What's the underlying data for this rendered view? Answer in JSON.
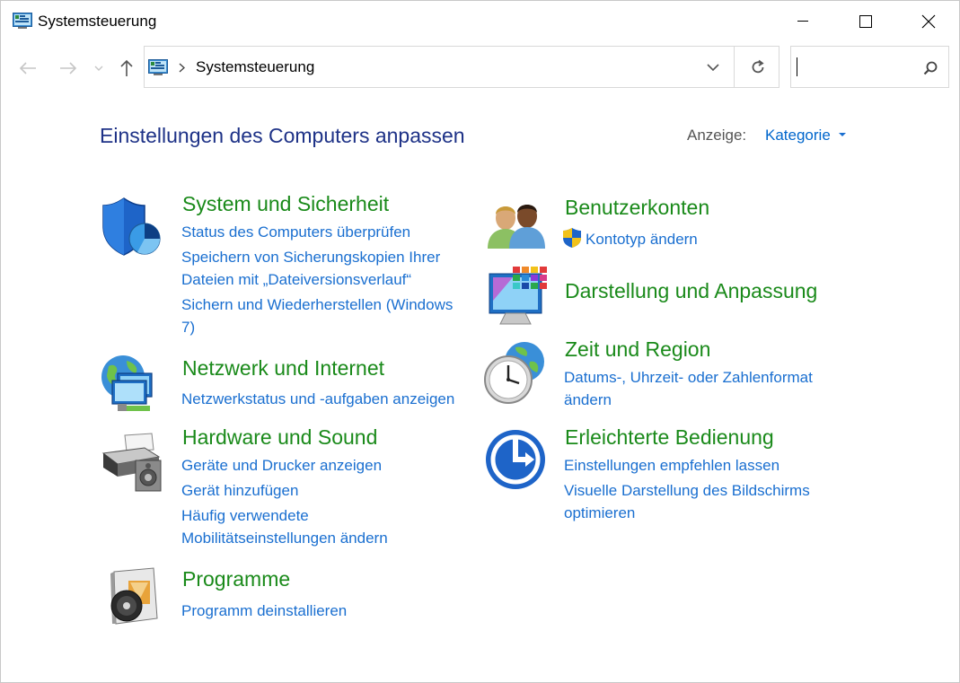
{
  "window": {
    "title": "Systemsteuerung"
  },
  "address_bar": {
    "path": "Systemsteuerung"
  },
  "search": {
    "value": ""
  },
  "header": {
    "title": "Einstellungen des Computers anpassen",
    "view_label": "Anzeige:",
    "view_value": "Kategorie"
  },
  "categories": {
    "system": {
      "title": "System und Sicherheit",
      "links": [
        "Status des Computers überprüfen",
        "Speichern von Sicherungskopien Ihrer",
        "Dateien mit „Dateiversionsverlauf“",
        "Sichern und Wiederherstellen (Windows",
        "7)"
      ]
    },
    "network": {
      "title": "Netzwerk und Internet",
      "links": [
        "Netzwerkstatus und -aufgaben anzeigen"
      ]
    },
    "hardware": {
      "title": "Hardware und Sound",
      "links": [
        "Geräte und Drucker anzeigen",
        "Gerät hinzufügen",
        "Häufig verwendete",
        "Mobilitätseinstellungen ändern"
      ]
    },
    "programs": {
      "title": "Programme",
      "links": [
        "Programm deinstallieren"
      ]
    },
    "accounts": {
      "title": "Benutzerkonten",
      "links": [
        "Kontotyp ändern"
      ]
    },
    "appearance": {
      "title": "Darstellung und Anpassung",
      "links": []
    },
    "clock": {
      "title": "Zeit und Region",
      "links": [
        "Datums-, Uhrzeit- oder Zahlenformat",
        "ändern"
      ]
    },
    "ease": {
      "title": "Erleichterte Bedienung",
      "links": [
        "Einstellungen empfehlen lassen",
        "Visuelle Darstellung des Bildschirms",
        "optimieren"
      ]
    }
  },
  "colors": {
    "heading_green": "#1a8a1a",
    "link_blue": "#1a6fd0",
    "title_navy": "#1e3287"
  },
  "icons": {
    "title": "control-panel-icon",
    "back": "arrow-left-icon",
    "forward": "arrow-right-icon",
    "recent": "chevron-down-icon",
    "up": "arrow-up-icon",
    "refresh": "refresh-icon",
    "search": "search-icon"
  }
}
